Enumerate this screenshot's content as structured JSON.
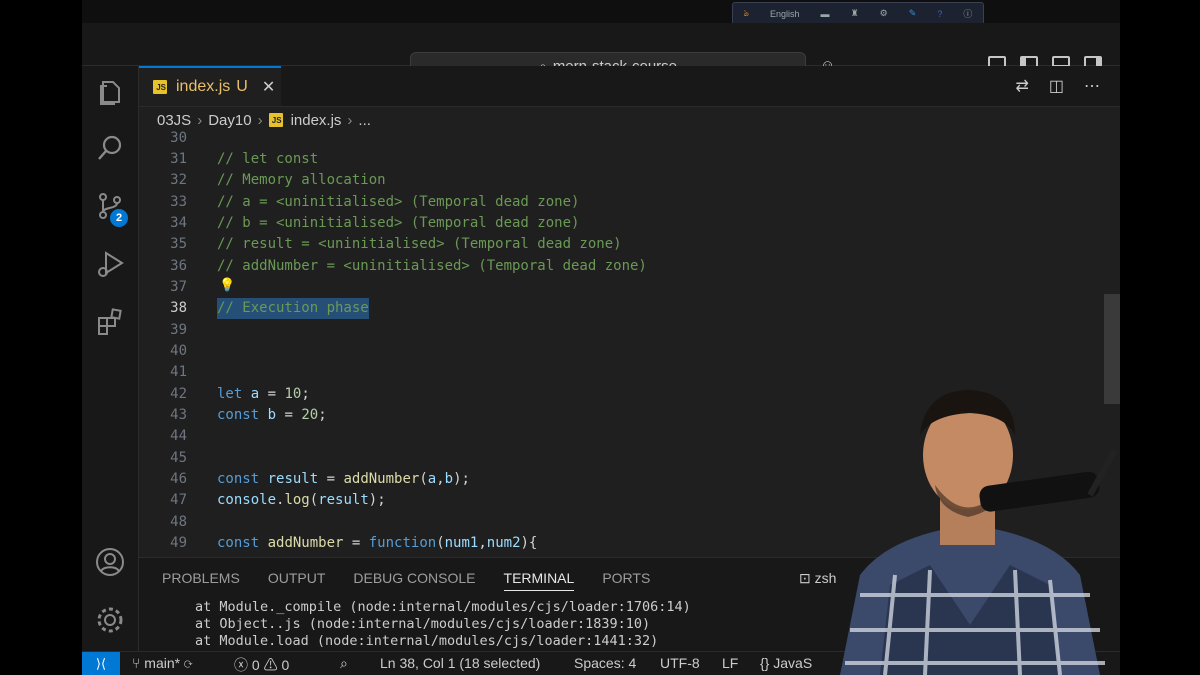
{
  "title_search": "mern-stack-course",
  "language_bar": "English",
  "tab": {
    "label": "index.js",
    "badge": "JS",
    "modified": "U",
    "close": "✕"
  },
  "breadcrumb": [
    "03JS",
    "Day10",
    "index.js",
    "..."
  ],
  "source_control_badge": "2",
  "code_lines": [
    {
      "n": "30",
      "html": ""
    },
    {
      "n": "31",
      "text": "// let const"
    },
    {
      "n": "32",
      "text": "// Memory allocation"
    },
    {
      "n": "33",
      "text": "// a = <uninitialised> (Temporal dead zone)"
    },
    {
      "n": "34",
      "text": "// b = <uninitialised> (Temporal dead zone)"
    },
    {
      "n": "35",
      "text": "// result = <uninitialised> (Temporal dead zone)"
    },
    {
      "n": "36",
      "text": "// addNumber = <uninitialised> (Temporal dead zone)"
    },
    {
      "n": "37",
      "text": ""
    },
    {
      "n": "38",
      "text": "// Execution phase"
    },
    {
      "n": "39",
      "text": ""
    },
    {
      "n": "40",
      "text": ""
    },
    {
      "n": "41",
      "text": ""
    },
    {
      "n": "42",
      "text": "let a = 10;"
    },
    {
      "n": "43",
      "text": "const b = 20;"
    },
    {
      "n": "44",
      "text": ""
    },
    {
      "n": "45",
      "text": ""
    },
    {
      "n": "46",
      "text": "const result = addNumber(a,b);"
    },
    {
      "n": "47",
      "text": "console.log(result);"
    },
    {
      "n": "48",
      "text": ""
    },
    {
      "n": "49",
      "text": "const addNumber = function(num1,num2){"
    }
  ],
  "panel_tabs": [
    "PROBLEMS",
    "OUTPUT",
    "DEBUG CONSOLE",
    "TERMINAL",
    "PORTS"
  ],
  "panel_active": "TERMINAL",
  "terminal_shell": "zsh",
  "terminal_lines": [
    "at Module._compile (node:internal/modules/cjs/loader:1706:14)",
    "at Object..js (node:internal/modules/cjs/loader:1839:10)",
    "at Module.load (node:internal/modules/cjs/loader:1441:32)"
  ],
  "status": {
    "branch": "main*",
    "errors": "0",
    "warnings": "0",
    "position": "Ln 38, Col 1 (18 selected)",
    "spaces": "Spaces: 4",
    "encoding": "UTF-8",
    "eol": "LF",
    "language": "JavaS"
  }
}
